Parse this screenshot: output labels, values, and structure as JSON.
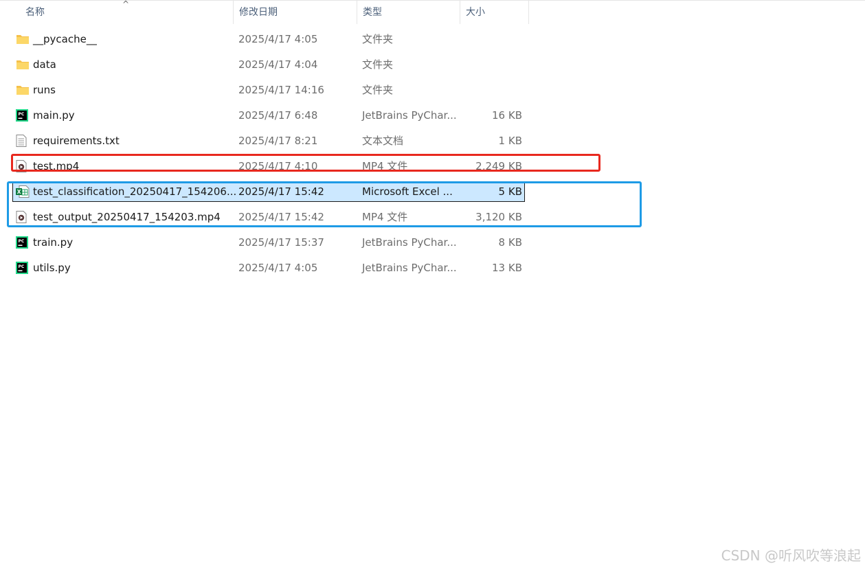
{
  "columns": {
    "name": "名称",
    "date": "修改日期",
    "type": "类型",
    "size": "大小"
  },
  "files": [
    {
      "name": "__pycache__",
      "date": "2025/4/17 4:05",
      "type": "文件夹",
      "size": "",
      "icon": "folder-icon"
    },
    {
      "name": "data",
      "date": "2025/4/17 4:04",
      "type": "文件夹",
      "size": "",
      "icon": "folder-icon"
    },
    {
      "name": "runs",
      "date": "2025/4/17 14:16",
      "type": "文件夹",
      "size": "",
      "icon": "folder-icon"
    },
    {
      "name": "main.py",
      "date": "2025/4/17 6:48",
      "type": "JetBrains PyChar...",
      "size": "16 KB",
      "icon": "pycharm-file-icon"
    },
    {
      "name": "requirements.txt",
      "date": "2025/4/17 8:21",
      "type": "文本文档",
      "size": "1 KB",
      "icon": "text-file-icon"
    },
    {
      "name": "test.mp4",
      "date": "2025/4/17 4:10",
      "type": "MP4 文件",
      "size": "2,249 KB",
      "icon": "video-file-icon"
    },
    {
      "name": "test_classification_20250417_154206...",
      "date": "2025/4/17 15:42",
      "type": "Microsoft Excel ...",
      "size": "5 KB",
      "icon": "excel-file-icon",
      "selected": true
    },
    {
      "name": "test_output_20250417_154203.mp4",
      "date": "2025/4/17 15:42",
      "type": "MP4 文件",
      "size": "3,120 KB",
      "icon": "video-file-icon"
    },
    {
      "name": "train.py",
      "date": "2025/4/17 15:37",
      "type": "JetBrains PyChar...",
      "size": "8 KB",
      "icon": "pycharm-file-icon"
    },
    {
      "name": "utils.py",
      "date": "2025/4/17 4:05",
      "type": "JetBrains PyChar...",
      "size": "13 KB",
      "icon": "pycharm-file-icon"
    }
  ],
  "watermark": "CSDN @听风吹等浪起",
  "colors": {
    "selection": "#cce8ff",
    "red_highlight": "#e8281e",
    "blue_highlight": "#1e9be6",
    "folder": "#f8c84a"
  }
}
